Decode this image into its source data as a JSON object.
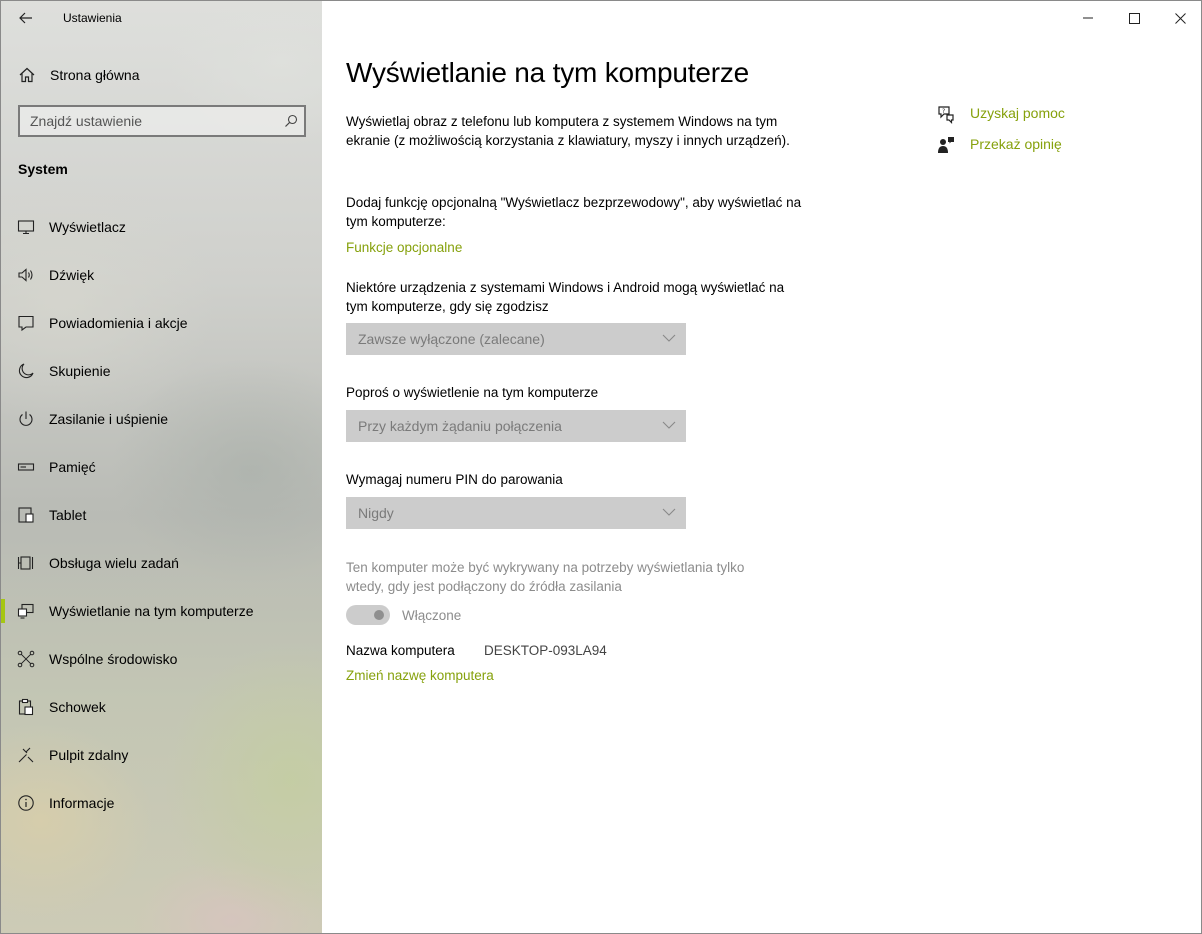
{
  "app": {
    "title": "Ustawienia"
  },
  "sidebar": {
    "home_label": "Strona główna",
    "search_placeholder": "Znajdź ustawienie",
    "section_label": "System",
    "items": [
      {
        "label": "Wyświetlacz",
        "icon": "monitor-icon"
      },
      {
        "label": "Dźwięk",
        "icon": "speaker-icon"
      },
      {
        "label": "Powiadomienia i akcje",
        "icon": "notification-icon"
      },
      {
        "label": "Skupienie",
        "icon": "moon-icon"
      },
      {
        "label": "Zasilanie i uśpienie",
        "icon": "power-icon"
      },
      {
        "label": "Pamięć",
        "icon": "storage-icon"
      },
      {
        "label": "Tablet",
        "icon": "tablet-icon"
      },
      {
        "label": "Obsługa wielu zadań",
        "icon": "multitasking-icon"
      },
      {
        "label": "Wyświetlanie na tym komputerze",
        "icon": "project-icon",
        "active": true
      },
      {
        "label": "Wspólne środowisko",
        "icon": "shared-experience-icon"
      },
      {
        "label": "Schowek",
        "icon": "clipboard-icon"
      },
      {
        "label": "Pulpit zdalny",
        "icon": "remote-desktop-icon"
      },
      {
        "label": "Informacje",
        "icon": "info-icon"
      }
    ]
  },
  "main": {
    "title": "Wyświetlanie na tym komputerze",
    "intro": "Wyświetlaj obraz z telefonu lub komputera z systemem Windows na tym ekranie (z możliwością korzystania z klawiatury, myszy i innych urządzeń).",
    "optional_text": "Dodaj funkcję opcjonalną \"Wyświetlacz bezprzewodowy\", aby wyświetlać na tym komputerze:",
    "optional_link": "Funkcje opcjonalne",
    "setting1_label": "Niektóre urządzenia z systemami Windows i Android mogą wyświetlać na tym komputerze, gdy się zgodzisz",
    "setting1_value": "Zawsze wyłączone (zalecane)",
    "setting2_label": "Poproś o wyświetlenie na tym komputerze",
    "setting2_value": "Przy każdym żądaniu połączenia",
    "setting3_label": "Wymagaj numeru PIN do parowania",
    "setting3_value": "Nigdy",
    "power_text": "Ten komputer może być wykrywany na potrzeby wyświetlania tylko wtedy, gdy jest podłączony do źródła zasilania",
    "toggle_label": "Włączone",
    "pc_name_label": "Nazwa komputera",
    "pc_name_value": "DESKTOP-093LA94",
    "rename_link": "Zmień nazwę komputera"
  },
  "help": {
    "get_help": "Uzyskaj pomoc",
    "feedback": "Przekaż opinię"
  },
  "colors": {
    "accent": "#86a10c",
    "active_bar": "#a5c613",
    "dropdown_bg": "#cccccc"
  }
}
